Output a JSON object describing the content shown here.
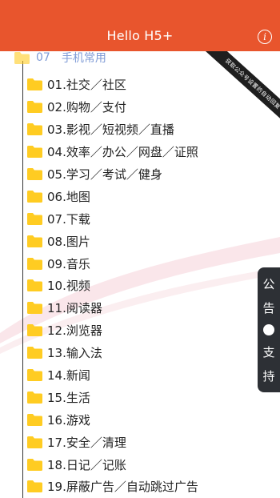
{
  "header": {
    "title": "Hello H5+",
    "info_icon": "info-icon",
    "info_glyph": "i",
    "bg_color": "#e8552d"
  },
  "partial_item": {
    "number": "07",
    "label": "手机常用"
  },
  "ribbon_text": "获取公众号设置的自动回复",
  "side_panel": {
    "top_text": "公告",
    "char1": "公",
    "char2": "告",
    "bottom_char1": "支",
    "bottom_char2": "持"
  },
  "items": [
    {
      "label": "01.社交／社区"
    },
    {
      "label": "02.购物／支付"
    },
    {
      "label": "03.影视／短视频／直播"
    },
    {
      "label": "04.效率／办公／网盘／证照"
    },
    {
      "label": "05.学习／考试／健身"
    },
    {
      "label": "06.地图"
    },
    {
      "label": "07.下载"
    },
    {
      "label": "08.图片"
    },
    {
      "label": "09.音乐"
    },
    {
      "label": "10.视频"
    },
    {
      "label": "11.阅读器"
    },
    {
      "label": "12.浏览器"
    },
    {
      "label": "13.输入法"
    },
    {
      "label": "14.新闻"
    },
    {
      "label": "15.生活"
    },
    {
      "label": "16.游戏"
    },
    {
      "label": "17.安全／清理"
    },
    {
      "label": "18.日记／记账"
    },
    {
      "label": "19.屏蔽广告／自动跳过广告"
    }
  ],
  "colors": {
    "folder": "#ffcc22",
    "partial_text": "#7f9bd6",
    "panel": "#2d3035"
  }
}
